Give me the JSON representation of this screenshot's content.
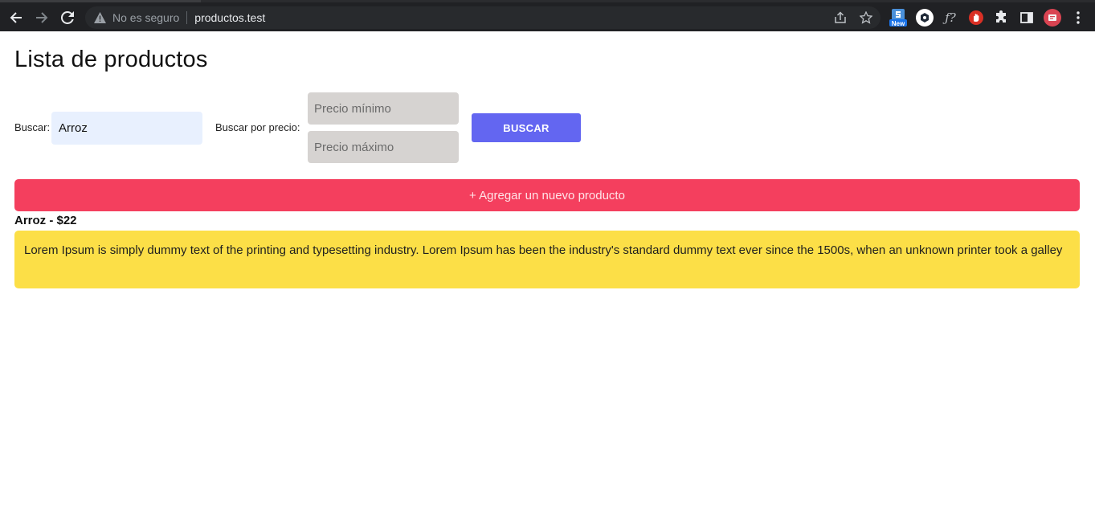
{
  "browser": {
    "security_text": "No es seguro",
    "url": "productos.test",
    "extensions": [
      "new-badge-extension",
      "hexagon-extension",
      "formula-extension",
      "hand-stop-extension",
      "puzzle-extension",
      "sidepanel-toggle",
      "profile-avatar",
      "menu-kebab"
    ],
    "new_badge": "New",
    "formula_label": "ƒ?"
  },
  "page": {
    "title": "Lista de productos"
  },
  "search": {
    "label": "Buscar:",
    "value": "Arroz",
    "price_label": "Buscar por precio:",
    "min_placeholder": "Precio mínimo",
    "max_placeholder": "Precio máximo",
    "button_label": "BUSCAR"
  },
  "add_button_label": "+ Agregar un nuevo producto",
  "products": [
    {
      "heading": "Arroz - $22",
      "description": "Lorem Ipsum is simply dummy text of the printing and typesetting industry. Lorem Ipsum has been the industry's standard dummy text ever since the 1500s, when an unknown printer took a galley"
    }
  ],
  "colors": {
    "chrome_bg": "#202124",
    "buscar_button": "#6366f1",
    "add_button": "#f43f5e",
    "product_card": "#fcdf47",
    "search_input": "#e8f0fe",
    "price_input": "#d6d3d1"
  }
}
